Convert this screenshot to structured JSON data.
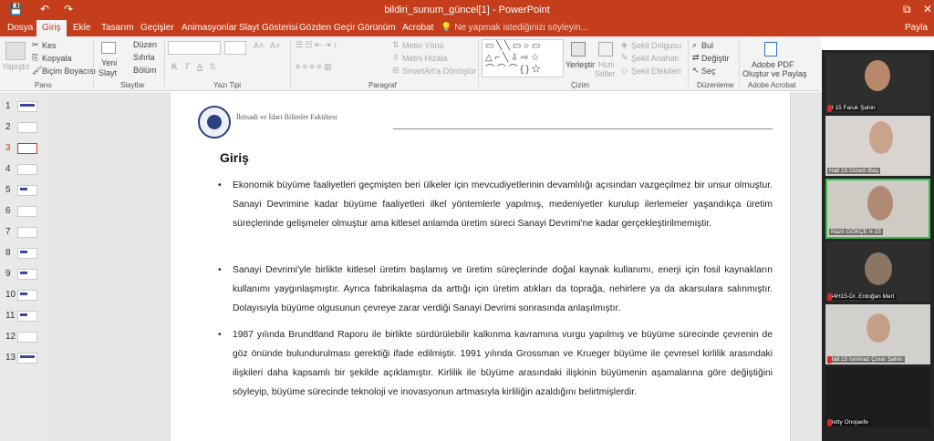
{
  "window": {
    "title": "bildiri_sunum_güncel[1] - PowerPoint",
    "save_icon": "💾",
    "undo_icon": "↶",
    "redo_icon": "↷",
    "restore_icon": "⧉",
    "close_icon": "✕"
  },
  "menu": {
    "tabs": [
      "Dosya",
      "Giriş",
      "Ekle",
      "Tasarım",
      "Geçişler",
      "Animasyonlar",
      "Slayt Gösterisi",
      "Gözden Geçir",
      "Görünüm",
      "Acrobat"
    ],
    "active": "Giriş",
    "tell_me": "Ne yapmak istediğinizi söyleyin...",
    "share": "Payla"
  },
  "ribbon": {
    "pano": {
      "paste": "Yapıştır",
      "cut": "Kes",
      "copy": "Kopyala",
      "format_painter": "Biçim Boyacısı",
      "label": "Pano"
    },
    "slaytlar": {
      "new_slide_1": "Yeni",
      "new_slide_2": "Slayt",
      "layout": "Düzen",
      "reset": "Sıfırla",
      "section": "Bölüm",
      "label": "Slaytlar"
    },
    "yazi_tipi": {
      "bold": "K",
      "italic": "T",
      "underline": "A",
      "strike": "S",
      "label": "Yazı Tipi"
    },
    "paragraf": {
      "text_direction": "Metin Yönü",
      "align_text": "Metni Hizala",
      "smartart": "SmartArt'a Dönüştür",
      "label": "Paragraf"
    },
    "cizim": {
      "arrange_1": "Yerleştir",
      "quick_1": "Hızlı",
      "quick_2": "Stiller",
      "fill": "Şekil Dolgusu",
      "outline": "Şekil Anahatı",
      "effects": "Şekil Efektleri",
      "label": "Çizim"
    },
    "duzenleme": {
      "find": "Bul",
      "replace": "Değiştir",
      "select": "Seç",
      "label": "Düzenleme"
    },
    "acrobat": {
      "create_1": "Adobe PDF",
      "create_2": "Oluştur ve Paylaş",
      "label": "Adobe Acrobat"
    }
  },
  "thumbnails": [
    "1",
    "2",
    "3",
    "4",
    "5",
    "6",
    "7",
    "8",
    "9",
    "10",
    "11",
    "12",
    "13"
  ],
  "selected_slide": "3",
  "slide": {
    "faculty": "İktisadi ve İdari Bilimler Fakültesi",
    "heading": "Giriş",
    "bullets": [
      "Ekonomik büyüme faaliyetleri geçmişten beri ülkeler için mevcudiyetlerinin devamlılığı açısından vazgeçilmez bir unsur olmuştur. Sanayi Devrimine kadar büyüme faaliyetleri ilkel yöntemlerle yapılmış, medeniyetler kurulup ilerlemeler yaşandıkça üretim süreçlerinde gelişmeler olmuştur ama kitlesel anlamda üretim süreci Sanayi Devrimi'ne kadar gerçekleştirilmemiştir.",
      "Sanayi Devrimi'yle birlikte kitlesel üretim başlamış ve üretim süreçlerinde doğal kaynak kullanımı, enerji için fosil kaynakların kullanımı yaygınlaşmıştır. Ayrıca fabrikalaşma da arttığı için üretim atıkları da toprağa, nehirlere ya da akarsulara salınmıştır. Dolayısıyla büyüme olgusunun çevreye zarar verdiği Sanayi Devrimi sonrasında anlaşılmıştır.",
      "1987 yılında Brundtland Raporu ile birlikte sürdürülebilir kalkınma kavramına vurgu yapılmış ve büyüme sürecinde çevrenin de göz önünde bulundurulması gerektiği ifade edilmiştir. 1991 yılında Grossman ve Krueger büyüme ile çevresel kirlilik arasındaki ilişkileri daha kapsamlı bir şekilde açıklamıştır. Kirlilik ile büyüme arasındaki ilişkinin büyümenin aşamalarına göre değiştiğini söyleyip, büyüme sürecinde teknoloji ve inovasyonun artmasıyla kirliliğin azaldığını belirtmişlerdir."
    ]
  },
  "participants": [
    "H 15 Faruk Şahin",
    "Hall 15 Gizem Baş",
    "Nazlı GÖKÇE h-15",
    "S4H15-Dr. Erdoğan Mert",
    "Hall 15 İsminaz Çınar Şahin",
    "Betty Onojaefe"
  ]
}
